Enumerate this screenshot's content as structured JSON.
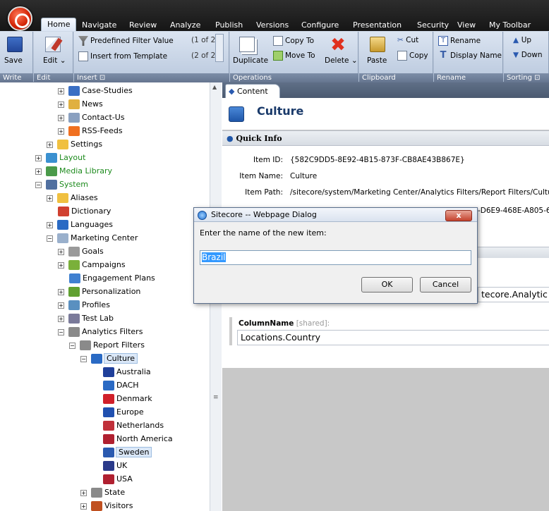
{
  "top_tabs": [
    "Home",
    "Navigate",
    "Review",
    "Analyze",
    "Publish",
    "Versions",
    "Configure",
    "Presentation",
    "Security",
    "View",
    "My Toolbar"
  ],
  "ribbon": {
    "write": {
      "save": "Save",
      "footer": "Write"
    },
    "edit": {
      "edit": "Edit",
      "footer": "Edit"
    },
    "insert": {
      "predefined": "Predefined Filter Value",
      "predefined_count": "(1 of 2)",
      "template": "Insert from Template",
      "template_count": "(2 of 2)",
      "footer": "Insert"
    },
    "operations": {
      "duplicate": "Duplicate",
      "copy_to": "Copy To",
      "move_to": "Move To",
      "delete": "Delete",
      "footer": "Operations"
    },
    "clipboard": {
      "paste": "Paste",
      "cut": "Cut",
      "copy": "Copy",
      "footer": "Clipboard"
    },
    "rename": {
      "rename": "Rename",
      "display_name": "Display Name",
      "footer": "Rename"
    },
    "sorting": {
      "up": "Up",
      "down": "Down",
      "footer": "Sorting"
    }
  },
  "tree": [
    {
      "label": "Case-Studies",
      "indent": 82,
      "pm": "+",
      "icon": "#3a6fc4"
    },
    {
      "label": "News",
      "indent": 82,
      "pm": "+",
      "icon": "#e0b040"
    },
    {
      "label": "Contact-Us",
      "indent": 82,
      "pm": "+",
      "icon": "#8aa0c0"
    },
    {
      "label": "RSS-Feeds",
      "indent": 82,
      "pm": "+",
      "icon": "#f07020"
    },
    {
      "label": "Settings",
      "indent": 66,
      "pm": "+",
      "icon": "#f0c040"
    },
    {
      "label": "Layout",
      "indent": 50,
      "pm": "+",
      "icon": "#3a90d0",
      "color": "#1c8a1c"
    },
    {
      "label": "Media Library",
      "indent": 50,
      "pm": "+",
      "icon": "#4a9a4a",
      "color": "#1c8a1c"
    },
    {
      "label": "System",
      "indent": 50,
      "pm": "−",
      "icon": "#5070a0",
      "color": "#1c8a1c"
    },
    {
      "label": "Aliases",
      "indent": 66,
      "pm": "+",
      "icon": "#f0c040"
    },
    {
      "label": "Dictionary",
      "indent": 82,
      "pm": "",
      "icon": "#d04030"
    },
    {
      "label": "Languages",
      "indent": 66,
      "pm": "+",
      "icon": "#2a6ac4"
    },
    {
      "label": "Marketing Center",
      "indent": 66,
      "pm": "−",
      "icon": "#9ab0cc"
    },
    {
      "label": "Goals",
      "indent": 82,
      "pm": "+",
      "icon": "#9a9a9a"
    },
    {
      "label": "Campaigns",
      "indent": 82,
      "pm": "+",
      "icon": "#7ab03a"
    },
    {
      "label": "Engagement Plans",
      "indent": 98,
      "pm": "",
      "icon": "#4080d0"
    },
    {
      "label": "Personalization",
      "indent": 82,
      "pm": "+",
      "icon": "#60a030"
    },
    {
      "label": "Profiles",
      "indent": 82,
      "pm": "+",
      "icon": "#5a90c0"
    },
    {
      "label": "Test Lab",
      "indent": 82,
      "pm": "+",
      "icon": "#7a7a9a"
    },
    {
      "label": "Analytics Filters",
      "indent": 82,
      "pm": "−",
      "icon": "#8a8a8a"
    },
    {
      "label": "Report Filters",
      "indent": 98,
      "pm": "−",
      "icon": "#8a8a8a"
    },
    {
      "label": "Culture",
      "indent": 114,
      "pm": "−",
      "icon": "#2a6ac4",
      "selected": true
    },
    {
      "label": "Australia",
      "indent": 146,
      "pm": "",
      "icon": "#1f3f9a"
    },
    {
      "label": "DACH",
      "indent": 146,
      "pm": "",
      "icon": "#2a6ac4"
    },
    {
      "label": "Denmark",
      "indent": 146,
      "pm": "",
      "icon": "#d0202a"
    },
    {
      "label": "Europe",
      "indent": 146,
      "pm": "",
      "icon": "#2050b0"
    },
    {
      "label": "Netherlands",
      "indent": 146,
      "pm": "",
      "icon": "#c0303a"
    },
    {
      "label": "North America",
      "indent": 146,
      "pm": "",
      "icon": "#b02030"
    },
    {
      "label": "Sweden",
      "indent": 146,
      "pm": "",
      "icon": "#2a5ab0",
      "highlight": true
    },
    {
      "label": "UK",
      "indent": 146,
      "pm": "",
      "icon": "#2a3a8a"
    },
    {
      "label": "USA",
      "indent": 146,
      "pm": "",
      "icon": "#b02030"
    },
    {
      "label": "State",
      "indent": 114,
      "pm": "+",
      "icon": "#8a8a8a"
    },
    {
      "label": "Visitors",
      "indent": 114,
      "pm": "+",
      "icon": "#c05020"
    }
  ],
  "content": {
    "tab_label": "Content",
    "title": "Culture",
    "quick_info_title": "Quick Info",
    "item_id_label": "Item ID:",
    "item_id": "{582C9DD5-8E92-4B15-873F-CB8AE43B867E}",
    "item_name_label": "Item Name:",
    "item_name": "Culture",
    "item_path_label": "Item Path:",
    "item_path": "/sitecore/system/Marketing Center/Analytics Filters/Report Filters/Culture",
    "template_partial": "-D6E9-468E-A805-6",
    "template_field_partial": "tecore.Analytic",
    "column_label": "ColumnName",
    "column_shared": "[shared]:",
    "column_value": "Locations.Country"
  },
  "dialog": {
    "title": "Sitecore -- Webpage Dialog",
    "prompt": "Enter the name of the new item:",
    "input_value": "Brazil",
    "ok": "OK",
    "cancel": "Cancel",
    "close": "x"
  }
}
